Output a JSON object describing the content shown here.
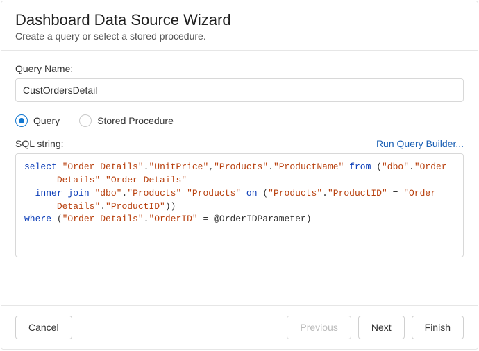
{
  "header": {
    "title": "Dashboard Data Source Wizard",
    "subtitle": "Create a query or select a stored procedure."
  },
  "query_name_label": "Query Name:",
  "query_name_value": "CustOrdersDetail",
  "radio": {
    "query": "Query",
    "stored_procedure": "Stored Procedure"
  },
  "sql_label": "SQL string:",
  "run_builder": "Run Query Builder...",
  "sql": {
    "t": [
      "select",
      " ",
      "\"Order Details\"",
      ".",
      "\"UnitPrice\"",
      ",",
      "\"Products\"",
      ".",
      "\"ProductName\"",
      " ",
      "from",
      " (",
      "\"dbo\"",
      ".",
      "\"Order\n      Details\"",
      " ",
      "\"Order Details\"",
      "\n  ",
      "inner join",
      " ",
      "\"dbo\"",
      ".",
      "\"Products\"",
      " ",
      "\"Products\"",
      " ",
      "on",
      " (",
      "\"Products\"",
      ".",
      "\"ProductID\"",
      " = ",
      "\"Order\n      Details\"",
      ".",
      "\"ProductID\"",
      "))",
      "\n",
      "where",
      " (",
      "\"Order Details\"",
      ".",
      "\"OrderID\"",
      " = @OrderIDParameter)"
    ],
    "c": [
      "kw",
      "pl",
      "str",
      "pl",
      "str",
      "pl",
      "str",
      "pl",
      "str",
      "pl",
      "kw",
      "pl",
      "str",
      "pl",
      "str",
      "pl",
      "str",
      "pl",
      "kw",
      "pl",
      "str",
      "pl",
      "str",
      "pl",
      "str",
      "pl",
      "kw",
      "pl",
      "str",
      "pl",
      "str",
      "pl",
      "str",
      "pl",
      "str",
      "pl",
      "pl",
      "kw",
      "pl",
      "str",
      "pl",
      "str",
      "pl"
    ]
  },
  "buttons": {
    "cancel": "Cancel",
    "previous": "Previous",
    "next": "Next",
    "finish": "Finish"
  }
}
